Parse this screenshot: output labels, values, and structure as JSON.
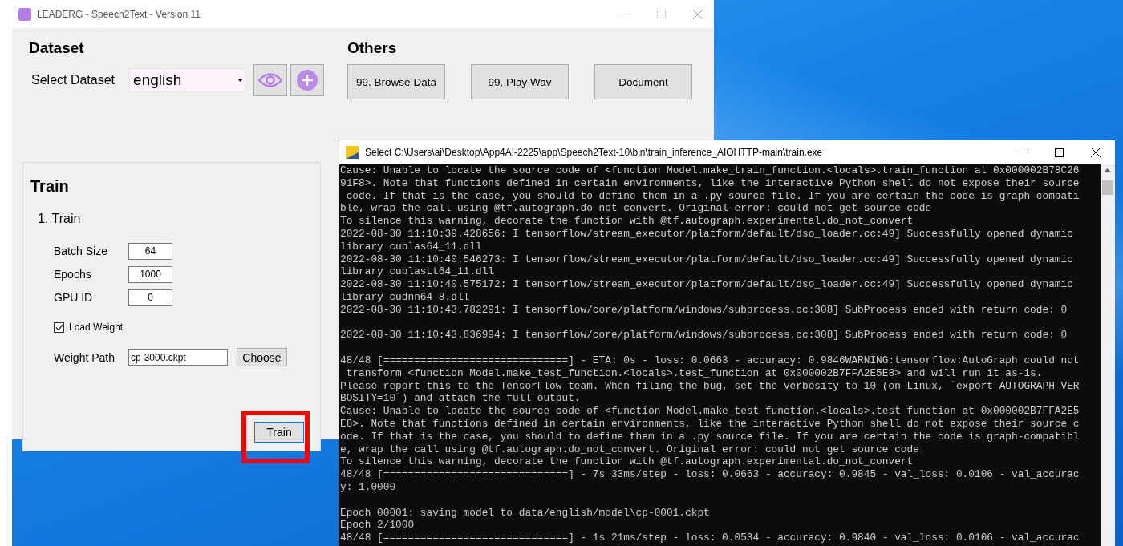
{
  "app_window": {
    "title": "LEADERG - Speech2Text - Version 11",
    "dataset": {
      "heading": "Dataset",
      "label": "Select Dataset",
      "value": "english"
    },
    "others": {
      "heading": "Others",
      "buttons": [
        "99. Browse Data",
        "99. Play Wav",
        "Document"
      ]
    },
    "train_panel": {
      "heading": "Train",
      "section": "1. Train",
      "fields": [
        {
          "label": "Batch Size",
          "value": "64"
        },
        {
          "label": "Epochs",
          "value": "1000"
        },
        {
          "label": "GPU ID",
          "value": "0"
        }
      ],
      "load_weight": {
        "label": "Load Weight",
        "checked": true
      },
      "weight_path": {
        "label": "Weight Path",
        "value": "cp-3000.ckpt"
      },
      "choose_button": "Choose",
      "train_button": "Train"
    }
  },
  "console_window": {
    "title": "Select C:\\Users\\ai\\Desktop\\App4AI-2225\\app\\Speech2Text-10\\bin\\train_inference_AIOHTTP-main\\train.exe",
    "blocks": [
      [
        "Cause: Unable to locate the source code of <function Model.make_train_function.<locals>.train_function at 0x000002B78C26",
        "91F8>. Note that functions defined in certain environments, like the interactive Python shell do not expose their source",
        " code. If that is the case, you should to define them in a .py source file. If you are certain the code is graph-compati",
        "ble, wrap the call using @tf.autograph.do_not_convert. Original error: could not get source code",
        "To silence this warning, decorate the function with @tf.autograph.experimental.do_not_convert",
        "2022-08-30 11:10:39.428656: I tensorflow/stream_executor/platform/default/dso_loader.cc:49] Successfully opened dynamic",
        "library cublas64_11.dll",
        "2022-08-30 11:10:40.546273: I tensorflow/stream_executor/platform/default/dso_loader.cc:49] Successfully opened dynamic",
        "library cublasLt64_11.dll",
        "2022-08-30 11:10:40.575172: I tensorflow/stream_executor/platform/default/dso_loader.cc:49] Successfully opened dynamic",
        "library cudnn64_8.dll",
        "2022-08-30 11:10:43.782291: I tensorflow/core/platform/windows/subprocess.cc:308] SubProcess ended with return code: 0"
      ],
      [
        "2022-08-30 11:10:43.836994: I tensorflow/core/platform/windows/subprocess.cc:308] SubProcess ended with return code: 0"
      ],
      [
        "48/48 [==============================] - ETA: 0s - loss: 0.0663 - accuracy: 0.9846WARNING:tensorflow:AutoGraph could not",
        " transform <function Model.make_test_function.<locals>.test_function at 0x000002B7FFA2E5E8> and will run it as-is.",
        "Please report this to the TensorFlow team. When filing the bug, set the verbosity to 10 (on Linux, `export AUTOGRAPH_VER",
        "BOSITY=10`) and attach the full output.",
        "Cause: Unable to locate the source code of <function Model.make_test_function.<locals>.test_function at 0x000002B7FFA2E5",
        "E8>. Note that functions defined in certain environments, like the interactive Python shell do not expose their source c",
        "ode. If that is the case, you should to define them in a .py source file. If you are certain the code is graph-compatibl",
        "e, wrap the call using @tf.autograph.do_not_convert. Original error: could not get source code",
        "To silence this warning, decorate the function with @tf.autograph.experimental.do_not_convert",
        "48/48 [==============================] - 7s 33ms/step - loss: 0.0663 - accuracy: 0.9845 - val_loss: 0.0106 - val_accurac",
        "y: 1.0000"
      ],
      [
        "Epoch 00001: saving model to data/english/model\\cp-0001.ckpt",
        "Epoch 2/1000",
        "48/48 [==============================] - 1s 21ms/step - loss: 0.0534 - accuracy: 0.9840 - val_loss: 0.0106 - val_accurac"
      ]
    ]
  }
}
